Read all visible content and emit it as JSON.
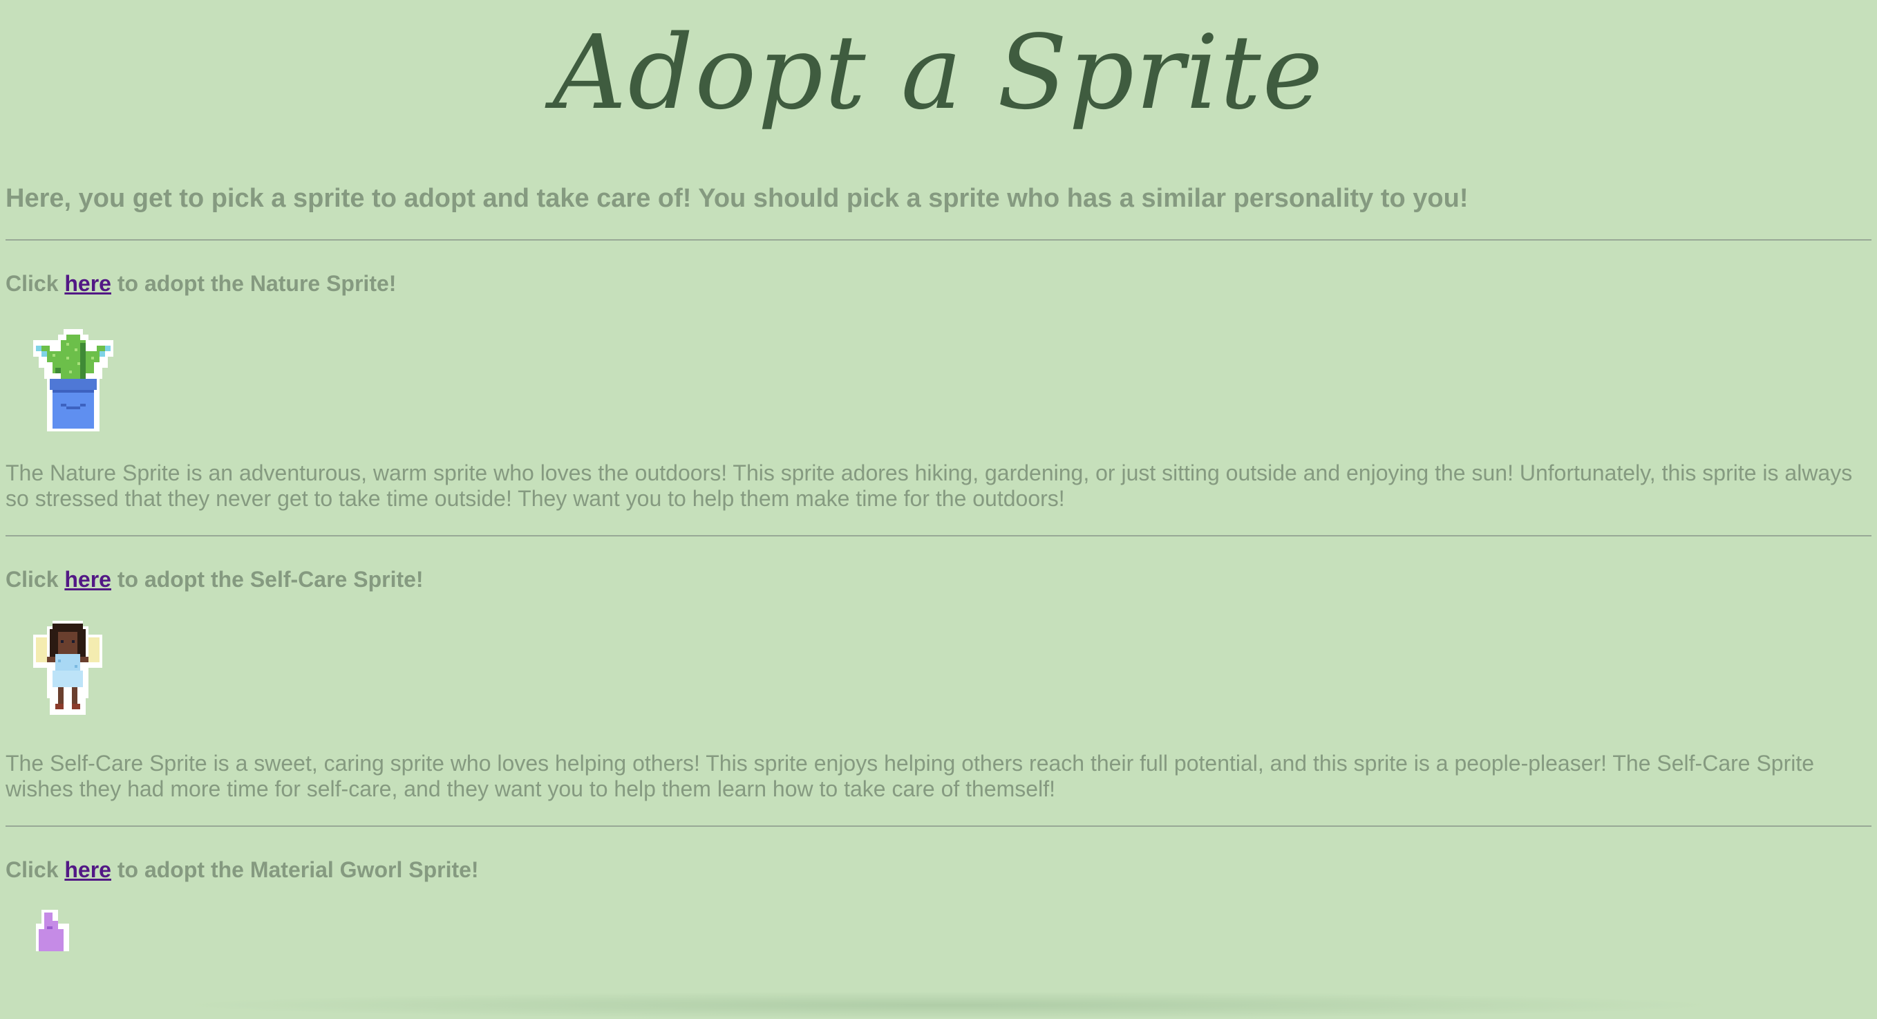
{
  "page": {
    "title": "Adopt a Sprite",
    "intro": "Here, you get to pick a sprite to adopt and take care of! You should pick a sprite who has a similar personality to you!"
  },
  "sprites": [
    {
      "click_prefix": "Click ",
      "link_label": "here",
      "click_suffix": " to adopt the Nature Sprite!",
      "icon": "cactus-sprite-icon",
      "description": "The Nature Sprite is an adventurous, warm sprite who loves the outdoors! This sprite adores hiking, gardening, or just sitting outside and enjoying the sun! Unfortunately, this sprite is always so stressed that they never get to take time outside! They want you to help them make time for the outdoors!"
    },
    {
      "click_prefix": "Click ",
      "link_label": "here",
      "click_suffix": " to adopt the Self-Care Sprite!",
      "icon": "fairy-sprite-icon",
      "description": "The Self-Care Sprite is a sweet, caring sprite who loves helping others! This sprite enjoys helping others reach their full potential, and this sprite is a people-pleaser! The Self-Care Sprite wishes they had more time for self-care, and they want you to help them learn how to take care of themself!"
    },
    {
      "click_prefix": "Click ",
      "link_label": "here",
      "click_suffix": " to adopt the Material Gworl Sprite!",
      "icon": "material-gworl-sprite-icon"
    }
  ],
  "colors": {
    "background": "#c6e0bb",
    "title": "#3f5c3f",
    "text": "#859a80",
    "link": "#521885"
  }
}
